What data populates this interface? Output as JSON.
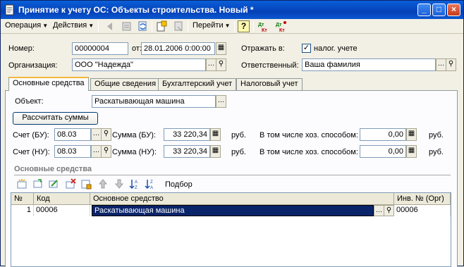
{
  "window": {
    "title": "Принятие к учету ОС: Объекты строительства. Новый *"
  },
  "toolbar": {
    "operation_menu": "Операция",
    "actions_menu": "Действия",
    "goto_menu": "Перейти",
    "help_icon": "?",
    "dt_kt_label": "Дт Кт",
    "dt_kt_label2": "Дт Кт"
  },
  "header": {
    "number_label": "Номер:",
    "number_value": "00000004",
    "date_label": "от:",
    "date_value": "28.01.2006  0:00:00",
    "reflect_label": "Отражать в:",
    "tax_checkbox_label": "налог. учете",
    "tax_checked": true,
    "org_label": "Организация:",
    "org_value": "ООО \"Надежда\"",
    "responsible_label": "Ответственный:",
    "responsible_value": "Ваша фамилия"
  },
  "tabs": [
    {
      "label": "Основные средства",
      "active": true
    },
    {
      "label": "Общие сведения",
      "active": false
    },
    {
      "label": "Бухгалтерский учет",
      "active": false
    },
    {
      "label": "Налоговый учет",
      "active": false
    }
  ],
  "main": {
    "object_label": "Объект:",
    "object_value": "Раскатывающая машина",
    "calc_button": "Рассчитать суммы",
    "bu_account_label": "Счет (БУ):",
    "bu_account_value": "08.03",
    "bu_sum_label": "Сумма (БУ):",
    "bu_sum_value": "33 220,34",
    "bu_currency": "руб.",
    "bu_econ_label": "В том числе хоз. способом:",
    "bu_econ_value": "0,00",
    "bu_econ_currency": "руб.",
    "nu_account_label": "Счет (НУ):",
    "nu_account_value": "08.03",
    "nu_sum_label": "Сумма (НУ):",
    "nu_sum_value": "33 220,34",
    "nu_currency": "руб.",
    "nu_econ_label": "В том числе хоз. способом:",
    "nu_econ_value": "0,00",
    "nu_econ_currency": "руб."
  },
  "assets": {
    "section_title": "Основные средства",
    "pick_label": "Подбор",
    "columns": [
      "№",
      "Код",
      "Основное средство",
      "Инв. № (Орг)"
    ],
    "rows": [
      {
        "num": "1",
        "code": "00006",
        "asset": "Раскатывающая машина",
        "inv": "00006"
      }
    ]
  },
  "colors": {
    "titlebar": "#0541b8",
    "selection": "#0a246a",
    "tab_highlight": "#f5b83c"
  }
}
